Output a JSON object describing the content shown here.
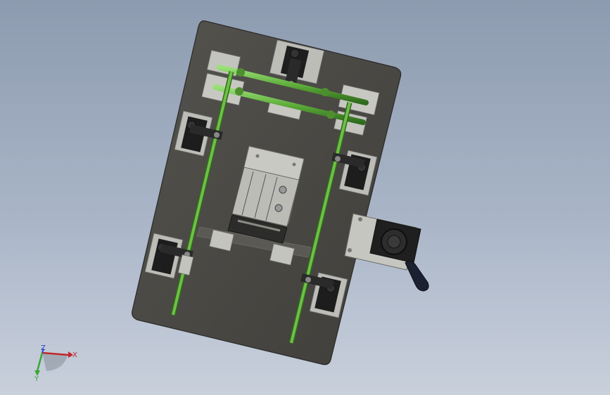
{
  "view": {
    "background_top": "#8d9bb0",
    "background_bottom": "#c9d0dc",
    "model_plate_color": "#4b4a45",
    "rod_color": "#6fbf47",
    "clamp_color": "#1d1d1d",
    "block_color": "#c8c8c4"
  },
  "triad": {
    "x_label": "X",
    "y_label": "Y",
    "z_label": "Z",
    "x_color": "#c0262b",
    "y_color": "#3aa63a",
    "z_color": "#2c48c9"
  }
}
